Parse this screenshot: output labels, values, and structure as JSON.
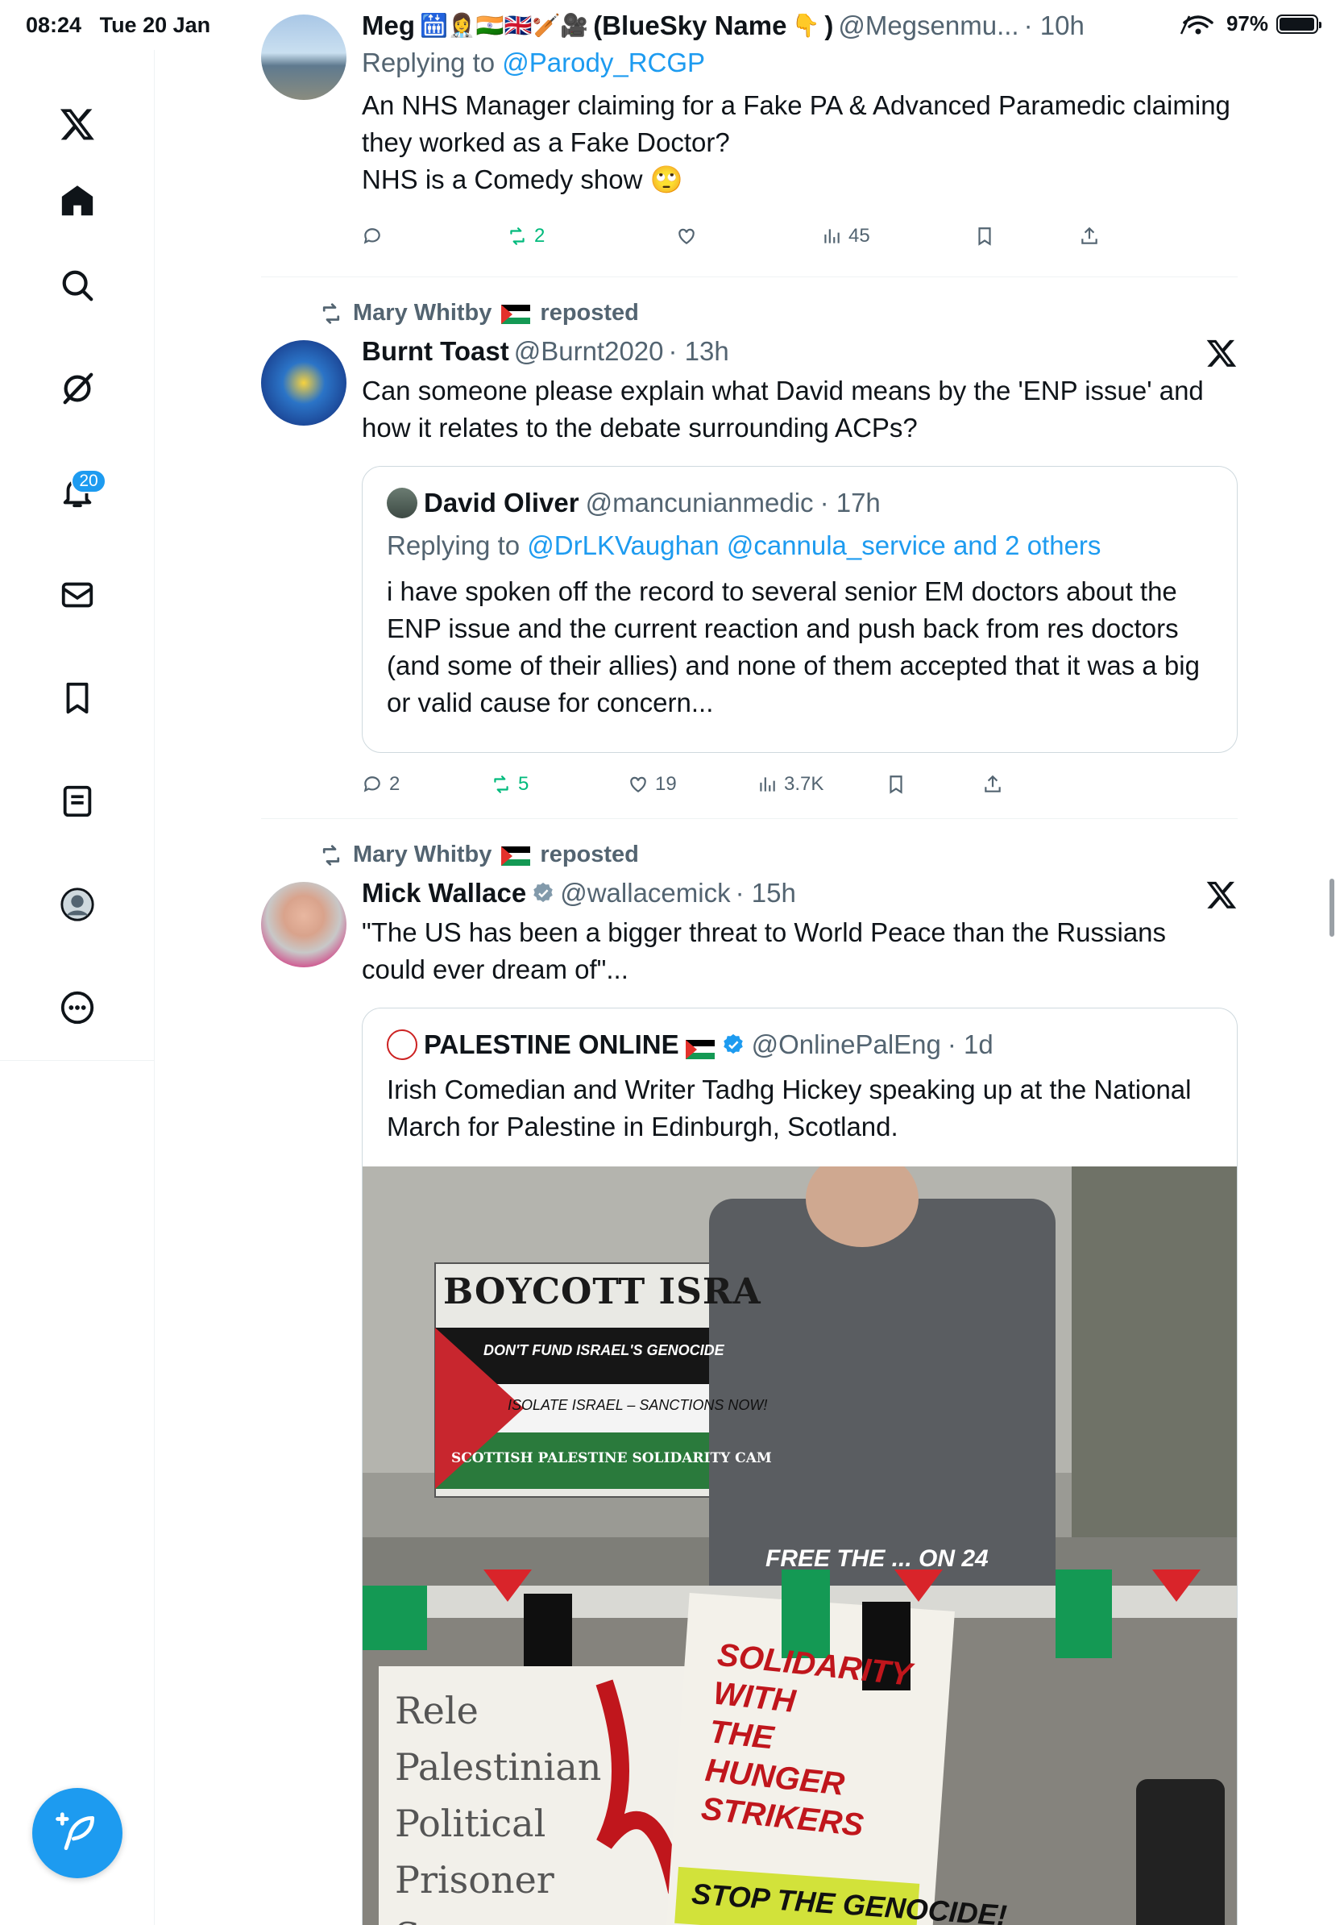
{
  "status_bar": {
    "time": "08:24",
    "date": "Tue 20 Jan",
    "battery": "97%",
    "battery_level": 0.97
  },
  "sidebar": {
    "items": [
      {
        "name": "x-logo"
      },
      {
        "name": "home"
      },
      {
        "name": "search"
      },
      {
        "name": "grok"
      },
      {
        "name": "notifications",
        "badge": "20"
      },
      {
        "name": "messages"
      },
      {
        "name": "bookmarks"
      },
      {
        "name": "lists"
      },
      {
        "name": "profile"
      },
      {
        "name": "more"
      }
    ]
  },
  "colors": {
    "accent": "#1d9bf0",
    "repost_green": "#00ba7c",
    "muted": "#536471"
  },
  "tweets": [
    {
      "name": "Meg",
      "name_suffix": "(BlueSky Name",
      "name_suffix_end": ")",
      "handle": "@Megsenmu...",
      "time": "· 10h",
      "reply_label": "Replying to",
      "reply_to": "@Parody_RCGP",
      "text": "An NHS Manager claiming for a Fake PA & Advanced Paramedic claiming they worked as a Fake Doctor?\nNHS is a Comedy show",
      "stats": {
        "replies": "",
        "reposts": "2",
        "likes": "",
        "views": "45"
      }
    },
    {
      "reposted_by": "Mary Whitby",
      "reposted_label": "reposted",
      "name": "Burnt Toast",
      "handle": "@Burnt2020",
      "time": "· 13h",
      "text": "Can someone please explain what David means by the 'ENP issue' and how it relates to the debate surrounding ACPs?",
      "quote": {
        "name": "David Oliver",
        "handle": "@mancunianmedic",
        "time": "· 17h",
        "reply_label": "Replying to",
        "reply_to": "@DrLKVaughan @cannula_service and 2 others",
        "text": "i have spoken off the record to several senior EM doctors about the ENP issue and the current reaction and push back from res doctors (and some of their allies) and none of them accepted that it was a big or valid cause for concern..."
      },
      "stats": {
        "replies": "2",
        "reposts": "5",
        "likes": "19",
        "views": "3.7K"
      }
    },
    {
      "reposted_by": "Mary Whitby",
      "reposted_label": "reposted",
      "name": "Mick Wallace",
      "handle": "@wallacemick",
      "time": "· 15h",
      "text": "\"The US has been a bigger threat to World Peace than the Russians could ever dream of\"...",
      "quote": {
        "name": "PALESTINE ONLINE",
        "handle": "@OnlinePalEng",
        "time": "· 1d",
        "text": "Irish Comedian and Writer Tadhg Hickey speaking up at the National March for Palestine in Edinburgh, Scotland.",
        "media": {
          "banner_line1": "BOYCOTT ISRA",
          "banner_line2": "DON'T FUND ISRAEL'S GENOCIDE",
          "banner_line3": "ISOLATE ISRAEL – SANCTIONS NOW!",
          "banner_line4": "SCOTTISH PALESTINE SOLIDARITY CAM",
          "sign_left": "Rele Palestinian Political Prisoner S",
          "sign_right_1": "SOLIDARITY WITH THE HUNGER STRIKERS",
          "sign_right_2": "STOP THE GENOCIDE!",
          "sign_top": "FREE THE ... ON 24"
        }
      }
    }
  ]
}
